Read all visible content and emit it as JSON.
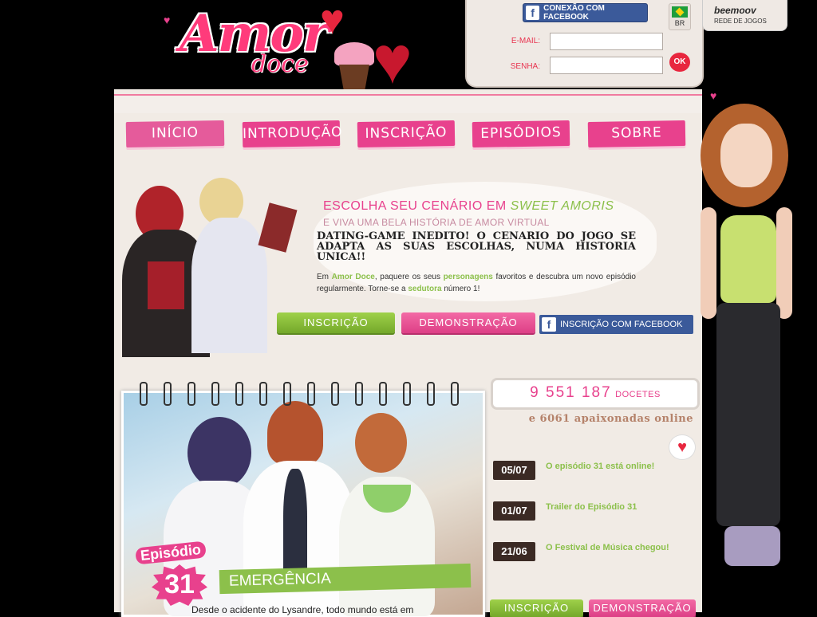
{
  "logo": {
    "word1": "Amor",
    "word2": "doce"
  },
  "login": {
    "facebook_connect": "CONEXÃO COM FACEBOOK",
    "email_label": "E-MAIL:",
    "password_label": "SENHA:",
    "ok_label": "OK",
    "language": "BR"
  },
  "network": {
    "name": "beemoov",
    "subtitle": "REDE DE JOGOS"
  },
  "nav": [
    {
      "label": "INÍCIO"
    },
    {
      "label": "INTRODUÇÃO"
    },
    {
      "label": "INSCRIÇÃO"
    },
    {
      "label": "EPISÓDIOS"
    },
    {
      "label": "SOBRE"
    }
  ],
  "hero": {
    "tagline1_a": "ESCOLHA SEU CENÁRIO EM ",
    "tagline1_b": "SWEET AMORIS",
    "tagline2": "E VIVA UMA BELA HISTÓRIA DE AMOR VIRTUAL",
    "tagline3": "DATING-GAME INEDITO! O CENARIO DO JOGO SE ADAPTA AS SUAS ESCOLHAS, NUMA HISTORIA UNICA!!",
    "desc_1": "Em ",
    "desc_2": "Amor Doce",
    "desc_3": ", paquere os seus ",
    "desc_4": "personagens",
    "desc_5": " favoritos e descubra um novo episódio regularmente. Torne-se a ",
    "desc_6": "sedutora",
    "desc_7": " número 1!"
  },
  "actions": {
    "signup": "INSCRIÇÃO",
    "demo": "DEMONSTRAÇÃO",
    "facebook_signup": "INSCRIÇÃO COM FACEBOOK"
  },
  "episode": {
    "word": "Episódio",
    "number": "31",
    "title": "EMERGÊNCIA",
    "caption": "Desde o acidente do Lysandre, todo mundo está em"
  },
  "stats": {
    "count": "9 551 187",
    "unit": "DOCETES",
    "online": "e 6061 apaixonadas online"
  },
  "news": [
    {
      "date": "05/07",
      "title": "O episódio 31 está online!"
    },
    {
      "date": "01/07",
      "title": "Trailer do Episódio 31"
    },
    {
      "date": "21/06",
      "title": "O Festival de Música chegou!"
    }
  ],
  "bottom_actions": {
    "signup": "INSCRIÇÃO",
    "demo": "DEMONSTRAÇÃO"
  },
  "colors": {
    "pink": "#e8418d",
    "green": "#8cc04b",
    "facebook": "#3b5a9a",
    "background": "#000000",
    "panel": "#f1ebe5"
  }
}
